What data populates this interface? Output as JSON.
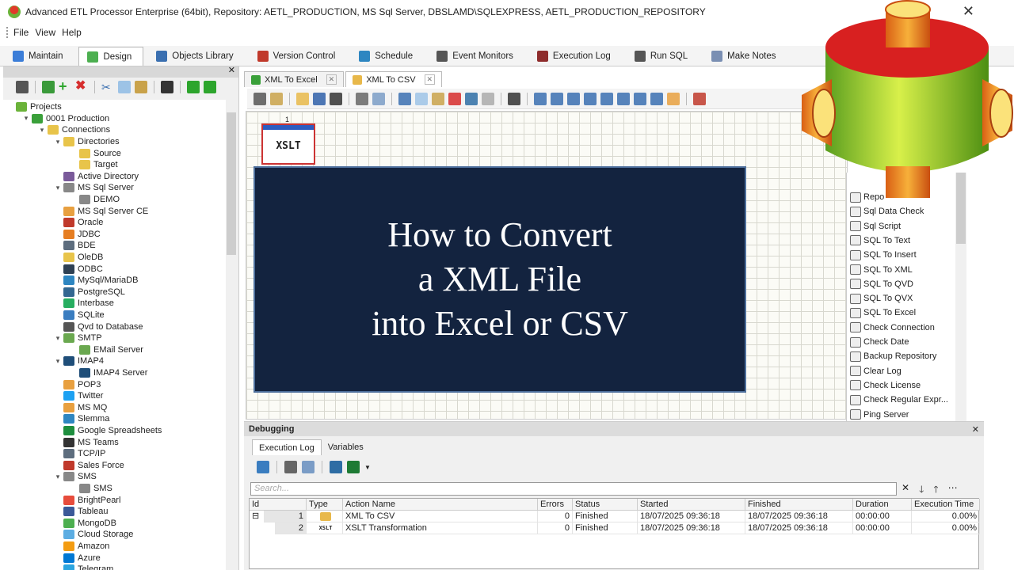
{
  "window": {
    "title": "Advanced ETL Processor Enterprise (64bit), Repository: AETL_PRODUCTION, MS Sql Server, DBSLAMD\\SQLEXPRESS, AETL_PRODUCTION_REPOSITORY",
    "close": "✕"
  },
  "menu": [
    "File",
    "View",
    "Help"
  ],
  "main_tabs": [
    {
      "label": "Maintain",
      "color": "#3b7dd8"
    },
    {
      "label": "Design",
      "color": "#4caf50"
    },
    {
      "label": "Objects Library",
      "color": "#3a6fb0"
    },
    {
      "label": "Version Control",
      "color": "#c0392b"
    },
    {
      "label": "Schedule",
      "color": "#2e86c1"
    },
    {
      "label": "Event Monitors",
      "color": "#555555"
    },
    {
      "label": "Execution Log",
      "color": "#8e2c2c"
    },
    {
      "label": "Run SQL",
      "color": "#555555"
    },
    {
      "label": "Make Notes",
      "color": "#7a8fb3"
    }
  ],
  "tree": [
    {
      "label": "Projects",
      "level": 0,
      "toggle": "",
      "color": "#6bb33a"
    },
    {
      "label": "0001 Production",
      "level": 1,
      "toggle": "▾",
      "color": "#3aa03a"
    },
    {
      "label": "Connections",
      "level": 2,
      "toggle": "▾",
      "color": "#e8c44a"
    },
    {
      "label": "Directories",
      "level": 3,
      "toggle": "▾",
      "color": "#e8c44a"
    },
    {
      "label": "Source",
      "level": 4,
      "toggle": "",
      "color": "#e8c44a"
    },
    {
      "label": "Target",
      "level": 4,
      "toggle": "",
      "color": "#e8c44a"
    },
    {
      "label": "Active Directory",
      "level": 3,
      "toggle": "",
      "color": "#7a5a9a"
    },
    {
      "label": "MS Sql Server",
      "level": 3,
      "toggle": "▾",
      "color": "#888888"
    },
    {
      "label": "DEMO",
      "level": 4,
      "toggle": "",
      "color": "#888888"
    },
    {
      "label": "MS Sql Server CE",
      "level": 3,
      "toggle": "",
      "color": "#e8a040"
    },
    {
      "label": "Oracle",
      "level": 3,
      "toggle": "",
      "color": "#c0392b"
    },
    {
      "label": "JDBC",
      "level": 3,
      "toggle": "",
      "color": "#e67e22"
    },
    {
      "label": "BDE",
      "level": 3,
      "toggle": "",
      "color": "#5d6d7e"
    },
    {
      "label": "OleDB",
      "level": 3,
      "toggle": "",
      "color": "#e8c44a"
    },
    {
      "label": "ODBC",
      "level": 3,
      "toggle": "",
      "color": "#2e4053"
    },
    {
      "label": "MySql/MariaDB",
      "level": 3,
      "toggle": "",
      "color": "#2e86c1"
    },
    {
      "label": "PostgreSQL",
      "level": 3,
      "toggle": "",
      "color": "#336791"
    },
    {
      "label": "Interbase",
      "level": 3,
      "toggle": "",
      "color": "#27ae60"
    },
    {
      "label": "SQLite",
      "level": 3,
      "toggle": "",
      "color": "#3a7dc0"
    },
    {
      "label": "Qvd to Database",
      "level": 3,
      "toggle": "",
      "color": "#555555"
    },
    {
      "label": "SMTP",
      "level": 3,
      "toggle": "▾",
      "color": "#6aa84f"
    },
    {
      "label": "EMail Server",
      "level": 4,
      "toggle": "",
      "color": "#6aa84f"
    },
    {
      "label": "IMAP4",
      "level": 3,
      "toggle": "▾",
      "color": "#1f4e79"
    },
    {
      "label": "IMAP4 Server",
      "level": 4,
      "toggle": "",
      "color": "#1f4e79"
    },
    {
      "label": "POP3",
      "level": 3,
      "toggle": "",
      "color": "#e8a040"
    },
    {
      "label": "Twitter",
      "level": 3,
      "toggle": "",
      "color": "#1da1f2"
    },
    {
      "label": "MS MQ",
      "level": 3,
      "toggle": "",
      "color": "#e8a040"
    },
    {
      "label": "Slemma",
      "level": 3,
      "toggle": "",
      "color": "#2e86c1"
    },
    {
      "label": "Google Spreadsheets",
      "level": 3,
      "toggle": "",
      "color": "#1e8e3e"
    },
    {
      "label": "MS Teams",
      "level": 3,
      "toggle": "",
      "color": "#333333"
    },
    {
      "label": "TCP/IP",
      "level": 3,
      "toggle": "",
      "color": "#5d6d7e"
    },
    {
      "label": "Sales Force",
      "level": 3,
      "toggle": "",
      "color": "#c0392b"
    },
    {
      "label": "SMS",
      "level": 3,
      "toggle": "▾",
      "color": "#888888"
    },
    {
      "label": "SMS",
      "level": 4,
      "toggle": "",
      "color": "#888888"
    },
    {
      "label": "BrightPearl",
      "level": 3,
      "toggle": "",
      "color": "#e74c3c"
    },
    {
      "label": "Tableau",
      "level": 3,
      "toggle": "",
      "color": "#3b5998"
    },
    {
      "label": "MongoDB",
      "level": 3,
      "toggle": "",
      "color": "#4caf50"
    },
    {
      "label": "Cloud Storage",
      "level": 3,
      "toggle": "",
      "color": "#5dade2"
    },
    {
      "label": "Amazon",
      "level": 3,
      "toggle": "",
      "color": "#f39c12"
    },
    {
      "label": "Azure",
      "level": 3,
      "toggle": "",
      "color": "#0078d4"
    },
    {
      "label": "Telegram",
      "level": 3,
      "toggle": "",
      "color": "#2ca5e0"
    }
  ],
  "doc_tabs": [
    {
      "label": "XML To Excel",
      "active": false
    },
    {
      "label": "XML To CSV",
      "active": true
    }
  ],
  "canvas": {
    "node_label": "XSLT",
    "node_number": "1"
  },
  "overlay": {
    "line1": "How to Convert",
    "line2": "a XML File",
    "line3": "into Excel or CSV"
  },
  "palette": [
    "Repo",
    "Sql Data Check",
    "Sql Script",
    "SQL To Text",
    "SQL To Insert",
    "SQL To XML",
    "SQL To QVD",
    "SQL To QVX",
    "SQL To Excel",
    "Check Connection",
    "Check Date",
    "Backup Repository",
    "Clear Log",
    "Check License",
    "Check Regular Expr...",
    "Ping Server"
  ],
  "debug": {
    "title": "Debugging",
    "close": "✕",
    "tabs": [
      "Execution Log",
      "Variables"
    ],
    "search_placeholder": "Search...",
    "search_buttons": [
      "✕",
      "🡓",
      "🡑",
      "⋯"
    ],
    "columns": [
      "Id",
      "Type",
      "Action Name",
      "Errors",
      "Status",
      "Started",
      "Finished",
      "Duration",
      "Execution Time"
    ],
    "rows": [
      {
        "expand": "⊟",
        "id": "1",
        "type": "",
        "action": "XML To CSV",
        "errors": "0",
        "status": "Finished",
        "started": "18/07/2025 09:36:18",
        "finished": "18/07/2025 09:36:18",
        "duration": "00:00:00",
        "exec": "0.00%"
      },
      {
        "expand": "",
        "id": "2",
        "type": "XSLT",
        "action": "XSLT Transformation",
        "errors": "0",
        "status": "Finished",
        "started": "18/07/2025 09:36:18",
        "finished": "18/07/2025 09:36:18",
        "duration": "00:00:00",
        "exec": "0.00%"
      }
    ]
  },
  "tree_header_close": "✕"
}
